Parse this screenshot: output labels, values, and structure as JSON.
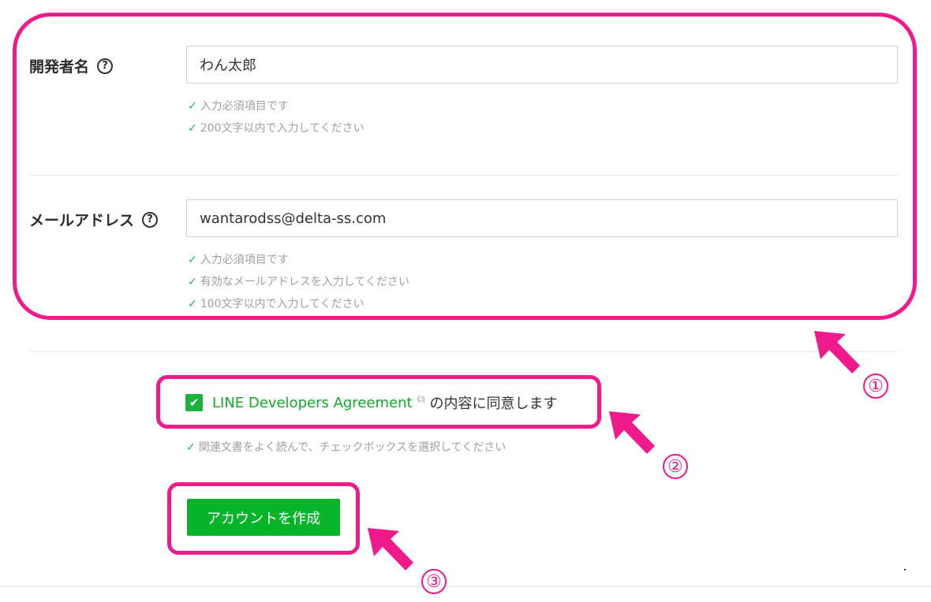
{
  "form": {
    "developer_name": {
      "label": "開発者名",
      "help_icon": "?",
      "value": "わん太郎",
      "validations": [
        "入力必須項目です",
        "200文字以内で入力してください"
      ]
    },
    "email": {
      "label": "メールアドレス",
      "help_icon": "?",
      "value": "wantarodss@delta-ss.com",
      "validations": [
        "入力必須項目です",
        "有効なメールアドレスを入力してください",
        "100文字以内で入力してください"
      ]
    },
    "agreement": {
      "link_text": "LINE Developers Agreement",
      "suffix": "の内容に同意します",
      "validation": "関連文書をよく読んで、チェックボックスを選択してください",
      "checked": true
    },
    "submit_label": "アカウントを作成"
  },
  "icons": {
    "check": "✓",
    "checkbox": "✔",
    "external": "⧉"
  },
  "annotations": {
    "numbers": [
      "①",
      "②",
      "③"
    ],
    "color": "#f01a8b"
  },
  "colors": {
    "link": "#15a72b",
    "button": "#06b42a",
    "validation_check": "#2bb34a"
  }
}
